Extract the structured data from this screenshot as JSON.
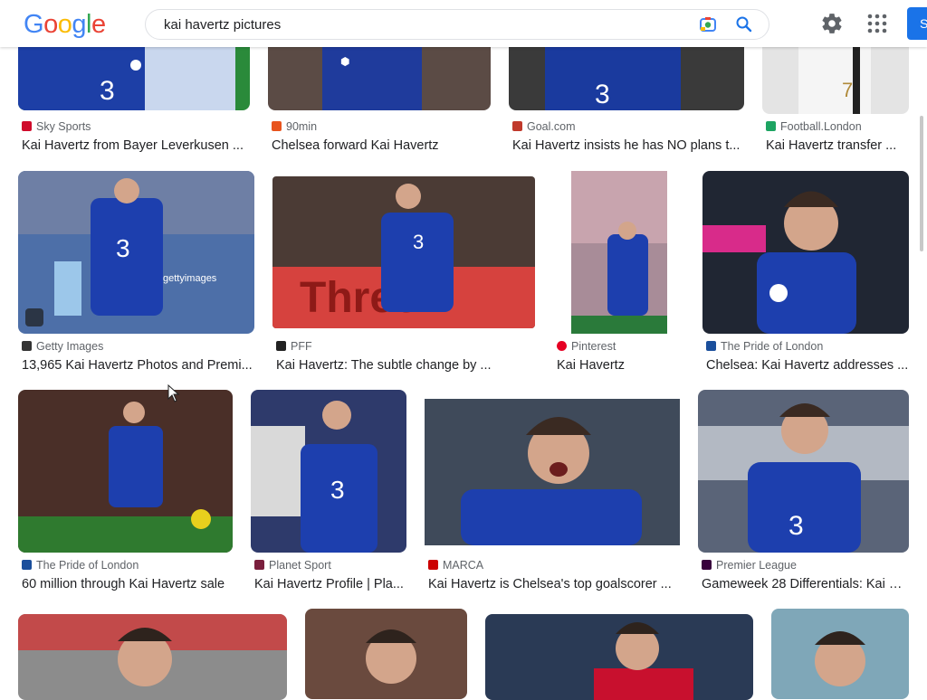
{
  "search": {
    "query": "kai havertz pictures"
  },
  "header": {
    "logo": "Google",
    "signin_label": "S"
  },
  "results": [
    {
      "source": "Sky Sports",
      "title": "Kai Havertz from Bayer Leverkusen ...",
      "favicon_color": "#d00b2b"
    },
    {
      "source": "90min",
      "title": "Chelsea forward Kai Havertz",
      "favicon_color": "#e8541e"
    },
    {
      "source": "Goal.com",
      "title": "Kai Havertz insists he has NO plans t...",
      "favicon_color": "#c0392b"
    },
    {
      "source": "Football.London",
      "title": "Kai Havertz transfer ...",
      "favicon_color": "#1da462"
    },
    {
      "source": "Getty Images",
      "title": "13,965 Kai Havertz Photos and Premi...",
      "favicon_color": "#333333"
    },
    {
      "source": "PFF",
      "title": "Kai Havertz: The subtle change by ...",
      "favicon_color": "#222222"
    },
    {
      "source": "Pinterest",
      "title": "Kai Havertz",
      "favicon_color": "#e60023"
    },
    {
      "source": "The Pride of London",
      "title": "Chelsea: Kai Havertz addresses ...",
      "favicon_color": "#1b4f9c"
    },
    {
      "source": "The Pride of London",
      "title": "60 million through Kai Havertz sale",
      "favicon_color": "#1b4f9c"
    },
    {
      "source": "Planet Sport",
      "title": "Kai Havertz Profile | Pla...",
      "favicon_color": "#7a1f3d"
    },
    {
      "source": "MARCA",
      "title": "Kai Havertz is Chelsea's top goalscorer ...",
      "favicon_color": "#cc0000"
    },
    {
      "source": "Premier League",
      "title": "Gameweek 28 Differentials: Kai H...",
      "favicon_color": "#38003c"
    }
  ]
}
